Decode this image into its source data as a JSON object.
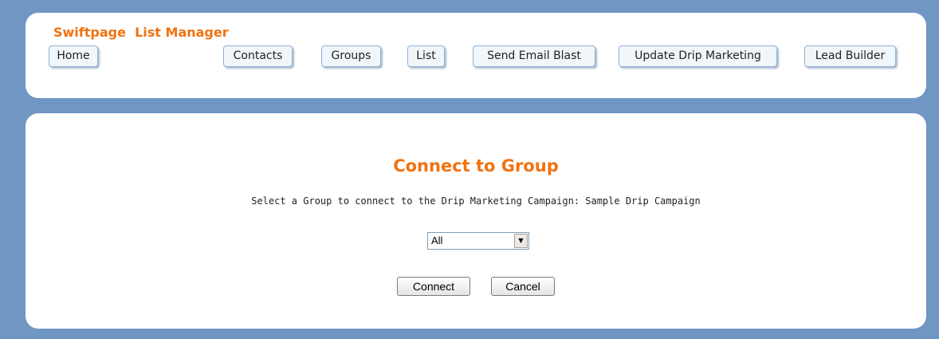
{
  "header": {
    "app_title": "Swiftpage  List Manager",
    "nav": [
      {
        "label": "Home"
      },
      {
        "label": "Contacts"
      },
      {
        "label": "Groups"
      },
      {
        "label": "List"
      },
      {
        "label": "Send Email Blast"
      },
      {
        "label": "Update Drip Marketing"
      },
      {
        "label": "Lead Builder"
      }
    ]
  },
  "main": {
    "title": "Connect to Group",
    "instruction": "Select a Group to connect to the Drip Marketing Campaign: Sample Drip Campaign",
    "group_select": {
      "selected": "All"
    },
    "connect_label": "Connect",
    "cancel_label": "Cancel"
  },
  "colors": {
    "background": "#7096c4",
    "accent": "#f2720f",
    "panel": "#ffffff"
  }
}
